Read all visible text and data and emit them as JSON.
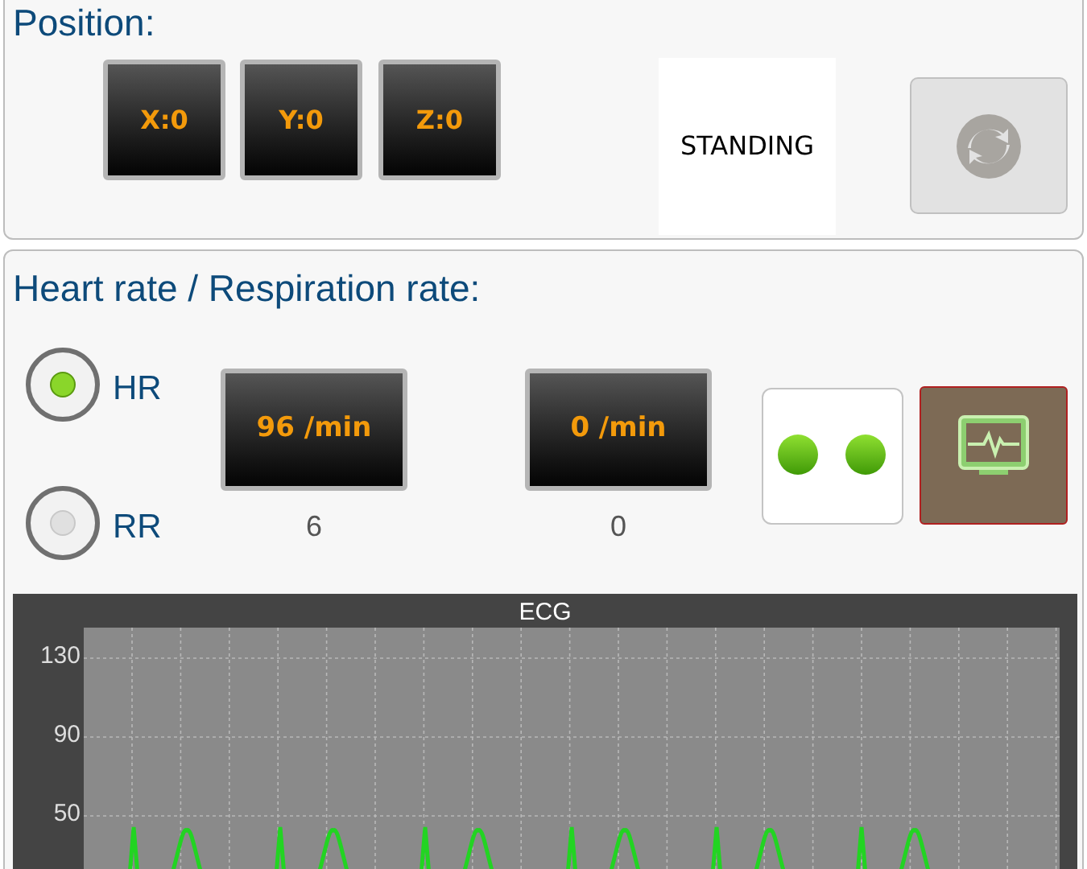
{
  "position": {
    "title": "Position:",
    "axes": [
      "X:0",
      "Y:0",
      "Z:0"
    ],
    "posture": "STANDING",
    "refresh_button": {
      "disabled": true
    }
  },
  "vitals": {
    "title": "Heart rate / Respiration rate:",
    "modes": [
      {
        "label": "HR",
        "selected": true
      },
      {
        "label": "RR",
        "selected": false
      }
    ],
    "readings": [
      {
        "value": "96 /min",
        "count": "6"
      },
      {
        "value": "0 /min",
        "count": "0"
      }
    ],
    "indicators": [
      {
        "on": true
      },
      {
        "on": true
      }
    ],
    "ecg": {
      "title": "ECG",
      "y_labels": [
        "130",
        "90",
        "50"
      ]
    }
  }
}
